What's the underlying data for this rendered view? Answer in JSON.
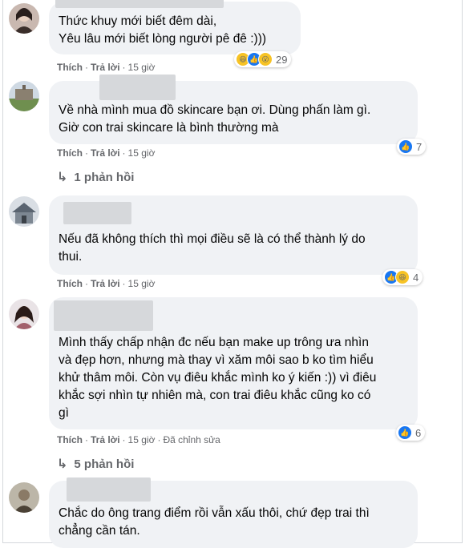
{
  "comments": [
    {
      "text": "Thức khuy mới biết đêm dài,\nYêu lâu mới biết lòng người pê đê :)))",
      "actions": {
        "like": "Thích",
        "reply": "Trả lời",
        "time": "15 giờ"
      },
      "reaction_count": "29",
      "reactions": [
        "haha-icon",
        "like-icon",
        "wow-icon"
      ]
    },
    {
      "text": "Về nhà mình mua đồ skincare bạn ơi. Dùng phấn làm gì.\nGiờ con trai skincare là bình thường mà",
      "actions": {
        "like": "Thích",
        "reply": "Trả lời",
        "time": "15 giờ"
      },
      "reaction_count": "7",
      "reactions": [
        "like-icon"
      ],
      "replies": "1 phản hồi"
    },
    {
      "text": "Nếu đã không thích thì mọi điều sẽ là có thể thành lý do\nthui.",
      "actions": {
        "like": "Thích",
        "reply": "Trả lời",
        "time": "15 giờ"
      },
      "reaction_count": "4",
      "reactions": [
        "like-icon",
        "haha-icon"
      ]
    },
    {
      "text": "Mình thấy chấp nhận đc nếu bạn make up trông ưa nhìn\nvà đẹp hơn, nhưng mà thay vì xăm môi sao b ko tìm hiểu\nkhử thâm môi. Còn vụ điêu khắc mình ko ý kiến :)) vì điêu\nkhắc sợi nhìn tự nhiên mà, con trai điêu khắc cũng ko có\ngì",
      "actions": {
        "like": "Thích",
        "reply": "Trả lời",
        "time": "15 giờ",
        "edited": "Đã chỉnh sửa"
      },
      "reaction_count": "6",
      "reactions": [
        "like-icon"
      ],
      "replies": "5 phản hồi"
    },
    {
      "text": "Chắc do ông trang điểm rồi vẫn xấu thôi, chứ đẹp trai thì\nchẳng cần tán."
    }
  ],
  "colors": {
    "bubble": "#f0f2f5",
    "meta": "#65676b",
    "like_blue": "#1877f2",
    "haha_yellow": "#f7c325"
  }
}
